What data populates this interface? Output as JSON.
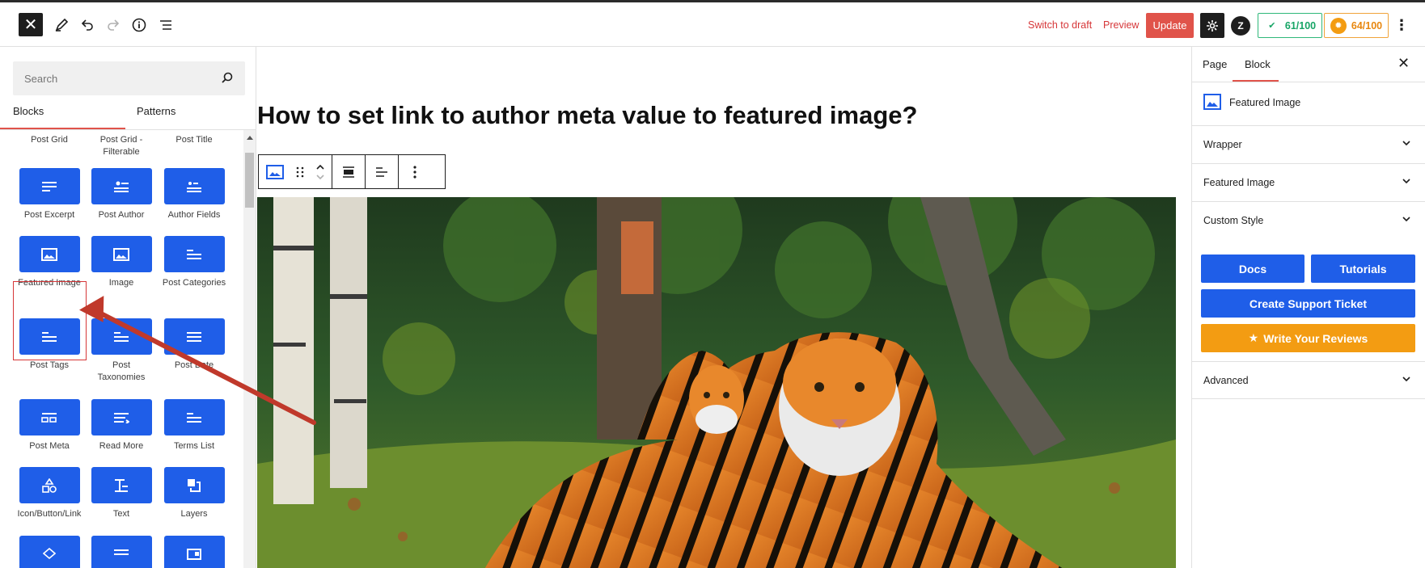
{
  "topbar": {
    "switch_to_draft": "Switch to draft",
    "preview": "Preview",
    "update": "Update",
    "seo_score": "61/100",
    "readability_score": "64/100"
  },
  "inserter": {
    "search_placeholder": "Search",
    "tabs": [
      "Blocks",
      "Patterns"
    ],
    "top_labels": [
      "Post Grid",
      "Post Grid - Filterable",
      "Post Title"
    ],
    "blocks": [
      {
        "label": "Post Excerpt",
        "icon": "excerpt-icon"
      },
      {
        "label": "Post Author",
        "icon": "author-icon"
      },
      {
        "label": "Author Fields",
        "icon": "author-fields-icon"
      },
      {
        "label": "Featured Image",
        "icon": "featured-image-icon"
      },
      {
        "label": "Image",
        "icon": "image-icon"
      },
      {
        "label": "Post Categories",
        "icon": "categories-icon"
      },
      {
        "label": "Post Tags",
        "icon": "tags-icon"
      },
      {
        "label": "Post Taxonomies",
        "icon": "taxonomies-icon"
      },
      {
        "label": "Post Date",
        "icon": "date-icon"
      },
      {
        "label": "Post Meta",
        "icon": "meta-icon"
      },
      {
        "label": "Read More",
        "icon": "read-more-icon"
      },
      {
        "label": "Terms List",
        "icon": "terms-list-icon"
      },
      {
        "label": "Icon/Button/Link",
        "icon": "icon-button-link-icon"
      },
      {
        "label": "Text",
        "icon": "text-icon"
      },
      {
        "label": "Layers",
        "icon": "layers-icon"
      }
    ]
  },
  "canvas": {
    "post_title": "How to set link to author meta value to featured image?",
    "image_alt": "Two tigers lying on grass in front of trees"
  },
  "settings": {
    "tabs": [
      "Page",
      "Block"
    ],
    "block_name": "Featured Image",
    "sections": [
      "Wrapper",
      "Featured Image",
      "Custom Style"
    ],
    "docs": "Docs",
    "tutorials": "Tutorials",
    "support": "Create Support Ticket",
    "reviews": "Write Your Reviews",
    "advanced": "Advanced"
  },
  "colors": {
    "accent": "#1f5ee8",
    "update": "#e0534a",
    "reviews": "#f39c12",
    "annotation": "#c0392b"
  }
}
